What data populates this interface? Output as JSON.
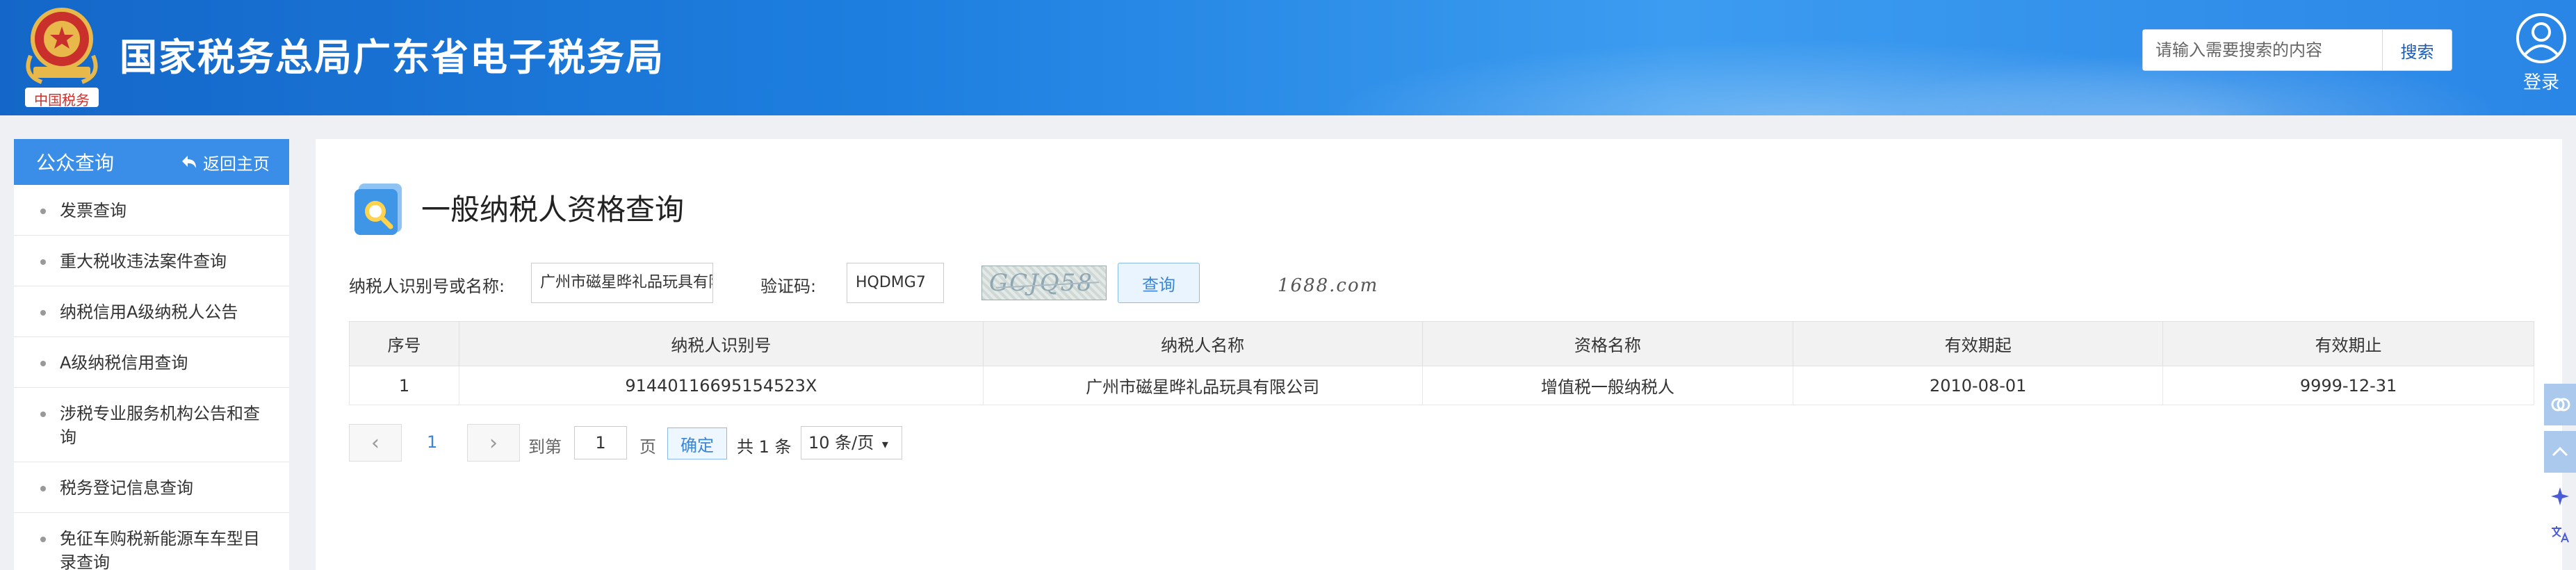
{
  "header": {
    "emblem_caption": "中国税务",
    "site_title": "国家税务总局广东省电子税务局",
    "search_placeholder": "请输入需要搜索的内容",
    "search_button": "搜索",
    "login_label": "登录"
  },
  "sidebar": {
    "title": "公众查询",
    "back_label": "返回主页",
    "items": [
      {
        "label": "发票查询"
      },
      {
        "label": "重大税收违法案件查询"
      },
      {
        "label": "纳税信用A级纳税人公告"
      },
      {
        "label": "A级纳税信用查询"
      },
      {
        "label": "涉税专业服务机构公告和查询"
      },
      {
        "label": "税务登记信息查询"
      },
      {
        "label": "免征车购税新能源车车型目录查询"
      }
    ]
  },
  "main": {
    "title": "一般纳税人资格查询",
    "form": {
      "taxpayer_label": "纳税人识别号或名称:",
      "taxpayer_value": "广州市磁星晔礼品玩具有限公司",
      "captcha_label": "验证码:",
      "captcha_value": "HQDMG7",
      "captcha_image_text": "GCJQ58",
      "query_button": "查询"
    },
    "watermark": "1688.com",
    "table": {
      "headers": [
        "序号",
        "纳税人识别号",
        "纳税人名称",
        "资格名称",
        "有效期起",
        "有效期止"
      ],
      "rows": [
        [
          "1",
          "91440116695154523X",
          "广州市磁星晔礼品玩具有限公司",
          "增值税一般纳税人",
          "2010-08-01",
          "9999-12-31"
        ]
      ]
    },
    "pager": {
      "prev": "‹",
      "current": "1",
      "next": "›",
      "goto_label": "到第",
      "goto_value": "1",
      "page_unit": "页",
      "confirm": "确定",
      "total": "共 1 条",
      "page_size": "10 条/页"
    }
  },
  "colors": {
    "header_blue": "#1e7fe0",
    "sidebar_head": "#3a8ee8",
    "link_blue": "#3a86d8"
  }
}
